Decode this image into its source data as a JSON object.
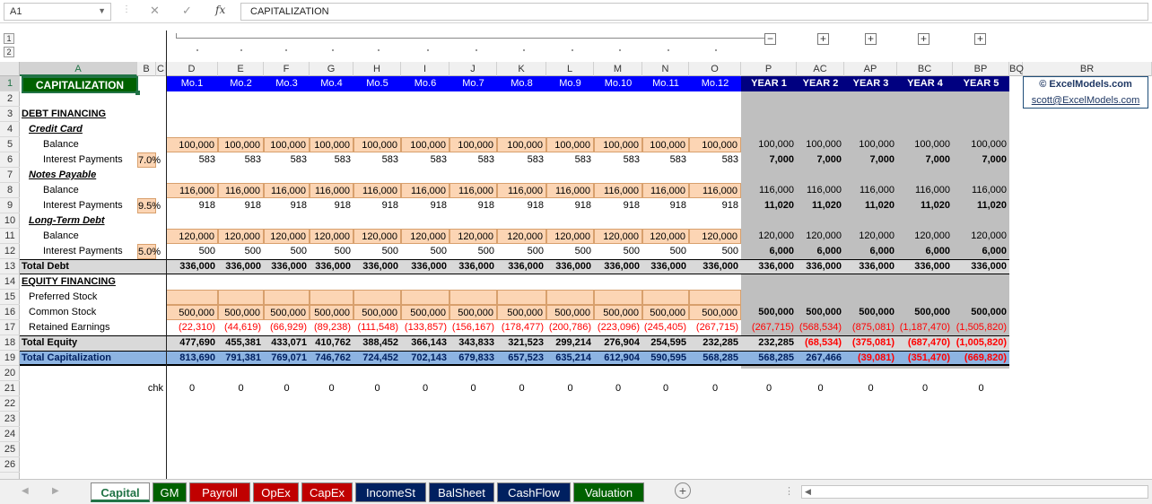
{
  "namebox": "A1",
  "formula": "CAPITALIZATION",
  "fx_label": "fx",
  "outline_levels": [
    "1",
    "2"
  ],
  "columns": [
    "A",
    "B",
    "C",
    "D",
    "E",
    "F",
    "G",
    "H",
    "I",
    "J",
    "K",
    "L",
    "M",
    "N",
    "O",
    "P",
    "AC",
    "AP",
    "BC",
    "BP",
    "BQ",
    "BR"
  ],
  "rows": [
    "1",
    "2",
    "3",
    "4",
    "5",
    "6",
    "7",
    "8",
    "9",
    "10",
    "11",
    "12",
    "13",
    "14",
    "15",
    "16",
    "17",
    "18",
    "19",
    "20",
    "21",
    "22",
    "23",
    "24",
    "25",
    "26"
  ],
  "title": "CAPITALIZATION",
  "months": [
    "Mo.1",
    "Mo.2",
    "Mo.3",
    "Mo.4",
    "Mo.5",
    "Mo.6",
    "Mo.7",
    "Mo.8",
    "Mo.9",
    "Mo.10",
    "Mo.11",
    "Mo.12"
  ],
  "years": [
    "YEAR 1",
    "YEAR 2",
    "YEAR 3",
    "YEAR 4",
    "YEAR 5"
  ],
  "brand": {
    "name": "© ExcelModels.com",
    "email": "scott@ExcelModels.com"
  },
  "labels": {
    "debt": "DEBT FINANCING",
    "credit": "Credit Card",
    "notes": "Notes Payable",
    "ltd": "Long-Term Debt",
    "balance": "Balance",
    "interest": "Interest Payments",
    "total_debt": "Total Debt",
    "equity": "EQUITY FINANCING",
    "preferred": "Preferred Stock",
    "common": "Common Stock",
    "retained": "Retained Earnings",
    "total_equity": "Total Equity",
    "total_cap": "Total Capitalization",
    "chk": "chk"
  },
  "rates": {
    "credit": "7.0%",
    "notes": "9.5%",
    "ltd": "5.0%"
  },
  "credit_balance": {
    "monthly": "100,000",
    "yearly": [
      "100,000",
      "100,000",
      "100,000",
      "100,000",
      "100,000"
    ]
  },
  "credit_interest": {
    "monthly": "583",
    "yearly": [
      "7,000",
      "7,000",
      "7,000",
      "7,000",
      "7,000"
    ]
  },
  "notes_balance": {
    "monthly": "116,000",
    "yearly": [
      "116,000",
      "116,000",
      "116,000",
      "116,000",
      "116,000"
    ]
  },
  "notes_interest": {
    "monthly": "918",
    "yearly": [
      "11,020",
      "11,020",
      "11,020",
      "11,020",
      "11,020"
    ]
  },
  "ltd_balance": {
    "monthly": "120,000",
    "yearly": [
      "120,000",
      "120,000",
      "120,000",
      "120,000",
      "120,000"
    ]
  },
  "ltd_interest": {
    "monthly": "500",
    "yearly": [
      "6,000",
      "6,000",
      "6,000",
      "6,000",
      "6,000"
    ]
  },
  "total_debt": {
    "monthly": "336,000",
    "yearly": [
      "336,000",
      "336,000",
      "336,000",
      "336,000",
      "336,000"
    ]
  },
  "common_stock": {
    "monthly": "500,000",
    "yearly": [
      "500,000",
      "500,000",
      "500,000",
      "500,000",
      "500,000"
    ]
  },
  "retained_monthly": [
    "(22,310)",
    "(44,619)",
    "(66,929)",
    "(89,238)",
    "(111,548)",
    "(133,857)",
    "(156,167)",
    "(178,477)",
    "(200,786)",
    "(223,096)",
    "(245,405)",
    "(267,715)"
  ],
  "retained_yearly": [
    "(267,715)",
    "(568,534)",
    "(875,081)",
    "(1,187,470)",
    "(1,505,820)"
  ],
  "total_equity_monthly": [
    "477,690",
    "455,381",
    "433,071",
    "410,762",
    "388,452",
    "366,143",
    "343,833",
    "321,523",
    "299,214",
    "276,904",
    "254,595",
    "232,285"
  ],
  "total_equity_yearly": [
    "232,285",
    "(68,534)",
    "(375,081)",
    "(687,470)",
    "(1,005,820)"
  ],
  "total_cap_monthly": [
    "813,690",
    "791,381",
    "769,071",
    "746,762",
    "724,452",
    "702,143",
    "679,833",
    "657,523",
    "635,214",
    "612,904",
    "590,595",
    "568,285"
  ],
  "total_cap_yearly": [
    "568,285",
    "267,466",
    "(39,081)",
    "(351,470)",
    "(669,820)"
  ],
  "chk_value": "0",
  "tabs": [
    {
      "label": "Capital",
      "color": "#ffffff",
      "active": true
    },
    {
      "label": "GM",
      "color": "#006100"
    },
    {
      "label": "Payroll",
      "color": "#c00000"
    },
    {
      "label": "OpEx",
      "color": "#c00000"
    },
    {
      "label": "CapEx",
      "color": "#c00000"
    },
    {
      "label": "IncomeSt",
      "color": "#002060"
    },
    {
      "label": "BalSheet",
      "color": "#002060"
    },
    {
      "label": "CashFlow",
      "color": "#002060"
    },
    {
      "label": "Valuation",
      "color": "#006100"
    }
  ],
  "colors": {
    "month_header": "#0000ff",
    "year_header": "#000080",
    "input_fill": "#fcd5b4",
    "yearly_fill": "#bfbfbf",
    "total_cap_fill": "#8db4e2",
    "negative": "#ff0000",
    "accent": "#217346"
  }
}
